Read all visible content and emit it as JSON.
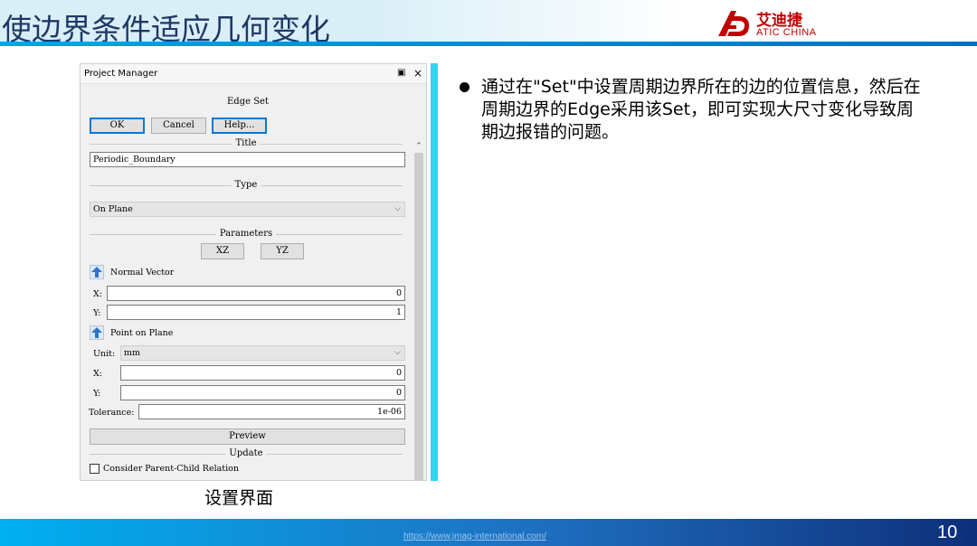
{
  "slide": {
    "title": "使边界条件适应几何变化",
    "logo": {
      "cn": "艾迪捷",
      "en": "ATIC CHINA"
    },
    "caption": "设置界面",
    "bullet": "通过在\"Set\"中设置周期边界所在的边的位置信息，然后在周期边界的Edge采用该Set，即可实现大尺寸变化导致周期边报错的问题。",
    "footer_url": "https://www.jmag-international.com/",
    "page_number": "10",
    "colors": {
      "title": "#1f3864",
      "accent": "#00a6e0",
      "logo": "#c00000"
    }
  },
  "window": {
    "title": "Project Manager",
    "restore_icon": "restore-icon",
    "close_label": "×",
    "dialog_title": "Edge Set",
    "buttons": {
      "ok": "OK",
      "cancel": "Cancel",
      "help": "Help..."
    },
    "sections": {
      "title": "Title",
      "type": "Type",
      "parameters": "Parameters",
      "update": "Update"
    },
    "title_value": "Periodic_Boundary",
    "type_value": "On Plane",
    "plane_buttons": {
      "xz": "XZ",
      "yz": "YZ"
    },
    "normal_vector": {
      "label": "Normal Vector",
      "x_label": "X:",
      "x": "0",
      "y_label": "Y:",
      "y": "1"
    },
    "point_on_plane": {
      "label": "Point on Plane",
      "unit_label": "Unit:",
      "unit": "mm",
      "x_label": "X:",
      "x": "0",
      "y_label": "Y:",
      "y": "0"
    },
    "tolerance": {
      "label": "Tolerance:",
      "value": "1e-06"
    },
    "preview": "Preview",
    "consider_relation": "Consider Parent-Child Relation"
  }
}
